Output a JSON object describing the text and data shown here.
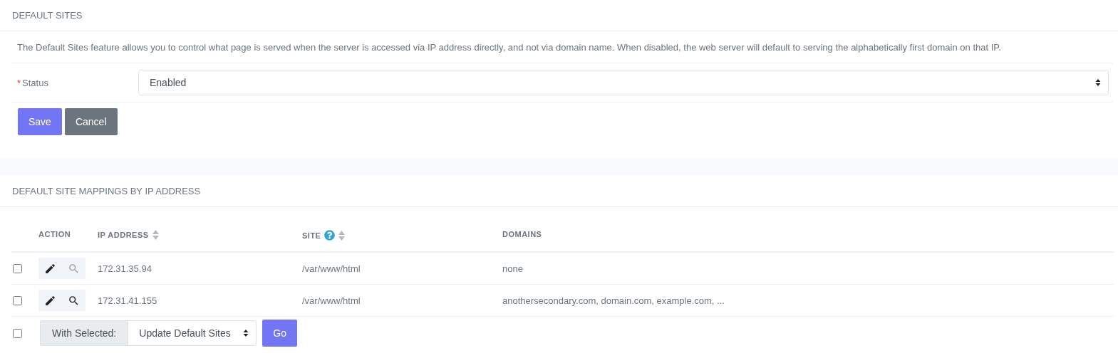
{
  "default_sites": {
    "title": "DEFAULT SITES",
    "description": "The Default Sites feature allows you to control what page is served when the server is accessed via IP address directly, and not via domain name. When disabled, the web server will default to serving the alphabetically first domain on that IP.",
    "status_field": {
      "label": "Status",
      "required_mark": "*",
      "value": "Enabled"
    },
    "buttons": [
      {
        "label": "Save",
        "kind": "primary"
      },
      {
        "label": "Cancel",
        "kind": "secondary"
      }
    ]
  },
  "mappings": {
    "title": "DEFAULT SITE MAPPINGS BY IP ADDRESS",
    "columns": [
      {
        "label": "ACTION",
        "sortable": false,
        "help": false
      },
      {
        "label": "IP ADDRESS",
        "sortable": true,
        "help": false
      },
      {
        "label": "SITE",
        "sortable": true,
        "help": true
      },
      {
        "label": "DOMAINS",
        "sortable": false,
        "help": false
      }
    ],
    "rows": [
      {
        "checked": false,
        "view_disabled": true,
        "ip": "172.31.35.94",
        "site": "/var/www/html",
        "domains": "none"
      },
      {
        "checked": false,
        "view_disabled": false,
        "ip": "172.31.41.155",
        "site": "/var/www/html",
        "domains": "anothersecondary.com, domain.com, example.com, ..."
      }
    ],
    "bulk": {
      "checked": false,
      "label": "With Selected:",
      "value": "Update Default Sites",
      "button": "Go"
    }
  }
}
